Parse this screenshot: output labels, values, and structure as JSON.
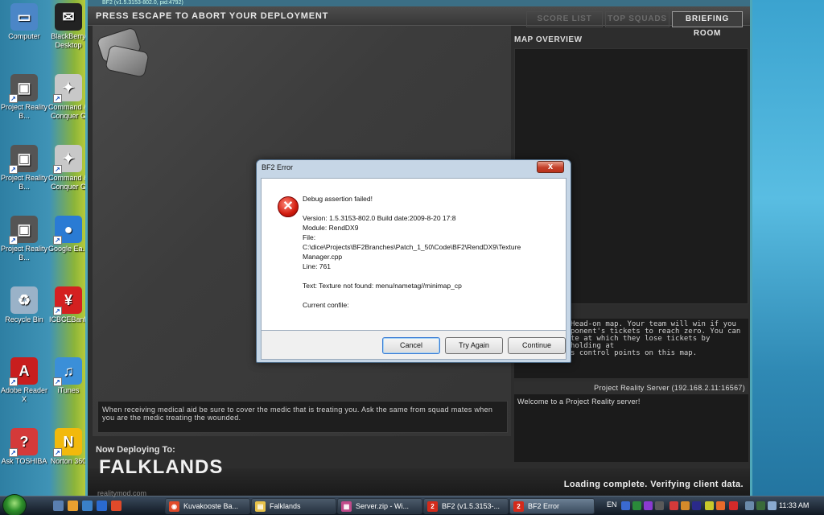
{
  "desktop": {
    "icons": [
      {
        "label": "Computer",
        "glyph": "▭",
        "color": "#4b86c7"
      },
      {
        "label": "BlackBerry Desktop",
        "glyph": "✉",
        "color": "#222222"
      },
      {
        "label": "Project Reality B...",
        "glyph": "▣",
        "color": "#555555"
      },
      {
        "label": "Command & Conquer G",
        "glyph": "✦",
        "color": "#c8c8c8"
      },
      {
        "label": "Project Reality B...",
        "glyph": "▣",
        "color": "#555555"
      },
      {
        "label": "Command & Conquer G",
        "glyph": "✦",
        "color": "#c8c8c8"
      },
      {
        "label": "Project Reality B...",
        "glyph": "▣",
        "color": "#555555"
      },
      {
        "label": "Google Ea...",
        "glyph": "●",
        "color": "#2a7bd4"
      },
      {
        "label": "Recycle Bin",
        "glyph": "♻",
        "color": "#9ab2c8"
      },
      {
        "label": "ICBCEBank",
        "glyph": "¥",
        "color": "#d42020"
      },
      {
        "label": "Adobe Reader X",
        "glyph": "A",
        "color": "#c81e1e"
      },
      {
        "label": "iTunes",
        "glyph": "♫",
        "color": "#3b8fd8"
      },
      {
        "label": "Ask TOSHIBA",
        "glyph": "?",
        "color": "#d43a3a"
      },
      {
        "label": "Norton 360",
        "glyph": "N",
        "color": "#f2b90c"
      }
    ]
  },
  "game": {
    "title_bar": "BF2 (v1.5.3153-802.0, pid:4792)",
    "escape_text": "PRESS ESCAPE TO ABORT YOUR DEPLOYMENT",
    "tabs": {
      "score": "SCORE LIST",
      "squads": "TOP SQUADS",
      "briefing": "BRIEFING ROOM"
    },
    "map_overview_title": "MAP OVERVIEW",
    "map_description": "Head-on map. Your team will win if you\nponent's tickets to reach zero. You can\nte at which they lose tickets by holding at\ns control points on this map.",
    "server_name": "Project Reality Server (192.168.2.11:16567)",
    "server_message": "Welcome to a Project Reality server!",
    "tip": "When receiving medical aid be sure to cover the medic that is treating you. Ask the same from squad mates when you are the medic treating the wounded.",
    "deploy_label": "Now Deploying To:",
    "map_name": "FALKLANDS",
    "site_url": "realitymod.com",
    "loading_status": "Loading complete.  Verifying client data."
  },
  "dialog": {
    "title": "BF2 Error",
    "close_glyph": "x",
    "error_glyph": "✕",
    "heading": "Debug assertion failed!",
    "version": "Version: 1.5.3153-802.0 Build date:2009-8-20 17:8",
    "module": "Module: RendDX9",
    "file_label": "File:",
    "file_path_1": "C:\\dice\\Projects\\BF2Branches\\Patch_1_50\\Code\\BF2\\RendDX9\\Texture",
    "file_path_2": "Manager.cpp",
    "line": "Line: 761",
    "text": "Text: Texture not found: menu/nametag//minimap_cp",
    "confile": "Current confile:",
    "buttons": {
      "cancel": "Cancel",
      "try_again": "Try Again",
      "continue": "Continue"
    }
  },
  "taskbar": {
    "tasks": [
      {
        "label": "Kuvakooste Ba...",
        "glyph": "◉",
        "color": "#e04a2a"
      },
      {
        "label": "Falklands",
        "glyph": "▤",
        "color": "#e8c24a"
      },
      {
        "label": "Server.zip - Wi...",
        "glyph": "▦",
        "color": "#c04a8a"
      },
      {
        "label": "BF2 (v1.5.3153-...",
        "glyph": "2",
        "color": "#d42a1a"
      },
      {
        "label": "BF2 Error",
        "glyph": "2",
        "color": "#d42a1a"
      }
    ],
    "language": "EN",
    "clock": "11:33 AM"
  }
}
